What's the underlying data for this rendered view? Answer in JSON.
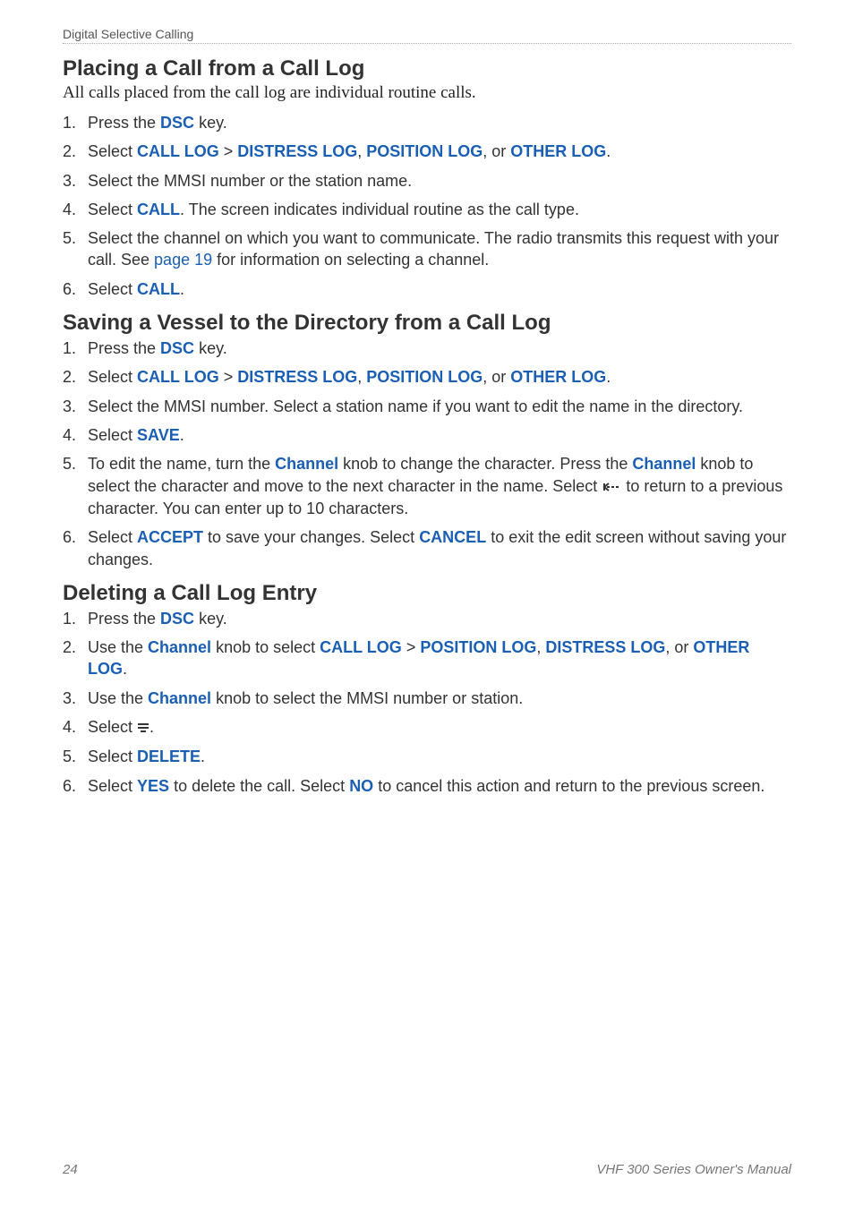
{
  "running_head": "Digital Selective Calling",
  "section1": {
    "title": "Placing a Call from a Call Log",
    "intro": "All calls placed from the call log are individual routine calls.",
    "steps": [
      {
        "pre": "Press the ",
        "ui": "DSC",
        "post": " key."
      },
      {
        "pre": "Select ",
        "ui1": "CALL LOG",
        "sep": " > ",
        "ui2": "DISTRESS LOG",
        "c1": ", ",
        "ui3": "POSITION LOG",
        "c2": ", or ",
        "ui4": "OTHER LOG",
        "end": "."
      },
      {
        "text": "Select the MMSI number or the station name."
      },
      {
        "pre": "Select ",
        "ui": "CALL",
        "post": ". The screen indicates individual routine as the call type."
      },
      {
        "pre": "Select the channel on which you want to communicate. The radio transmits this request with your call. See ",
        "link": "page 19",
        "post": " for information on selecting a channel."
      },
      {
        "pre": "Select ",
        "ui": "CALL",
        "post": "."
      }
    ]
  },
  "section2": {
    "title": "Saving a Vessel to the Directory from a Call Log",
    "steps": [
      {
        "pre": "Press the ",
        "ui": "DSC",
        "post": " key."
      },
      {
        "pre": "Select ",
        "ui1": "CALL LOG",
        "sep": " > ",
        "ui2": "DISTRESS LOG",
        "c1": ", ",
        "ui3": "POSITION LOG",
        "c2": ", or ",
        "ui4": "OTHER LOG",
        "end": "."
      },
      {
        "text": "Select the MMSI number. Select a station name if you want to edit the name in the directory."
      },
      {
        "pre": "Select ",
        "ui": "SAVE",
        "post": "."
      },
      {
        "pre": "To edit the name, turn the ",
        "ui1": "Channel",
        "mid1": " knob to change the character. Press the ",
        "ui2": "Channel",
        "mid2": " knob to select the character and move to the next character in the name. Select ",
        "icon": "back",
        "post": " to return to a previous character. You can enter up to 10 characters."
      },
      {
        "pre": "Select ",
        "ui1": "ACCEPT",
        "mid": " to save your changes. Select ",
        "ui2": "CANCEL",
        "post": " to exit the edit screen without saving your changes."
      }
    ]
  },
  "section3": {
    "title": "Deleting a Call Log Entry",
    "steps": [
      {
        "pre": "Press the ",
        "ui": "DSC",
        "post": " key."
      },
      {
        "pre": "Use the ",
        "ui1": "Channel",
        "mid1": " knob to select ",
        "ui2": "CALL LOG",
        "sep": " > ",
        "ui3": "POSITION LOG",
        "c1": ", ",
        "ui4": "DISTRESS LOG",
        "c2": ", or ",
        "ui5": "OTHER LOG",
        "end": "."
      },
      {
        "pre": "Use the ",
        "ui": "Channel",
        "post": " knob to select the MMSI number or station."
      },
      {
        "pre": "Select ",
        "icon": "menu",
        "post": "."
      },
      {
        "pre": "Select ",
        "ui": "DELETE",
        "post": "."
      },
      {
        "pre": "Select ",
        "ui1": "YES",
        "mid": " to delete the call. Select ",
        "ui2": "NO",
        "post": " to cancel this action and return to the previous screen."
      }
    ]
  },
  "footer": {
    "page": "24",
    "doc": "VHF 300 Series Owner's Manual"
  }
}
